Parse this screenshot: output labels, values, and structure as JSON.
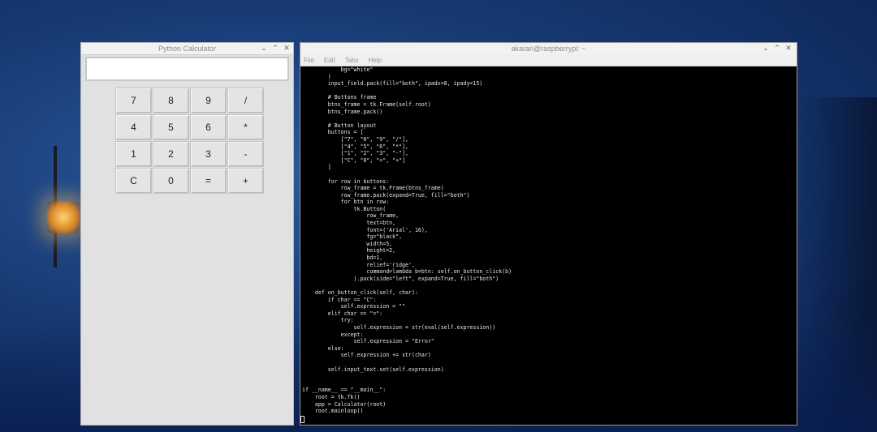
{
  "calculator": {
    "title": "Python Calculator",
    "input_value": "",
    "buttons": [
      "7",
      "8",
      "9",
      "/",
      "4",
      "5",
      "6",
      "*",
      "1",
      "2",
      "3",
      "-",
      "C",
      "0",
      "=",
      "+"
    ]
  },
  "terminal": {
    "title": "akaran@raspberrypi: ~",
    "menu": [
      "File",
      "Edit",
      "Tabs",
      "Help"
    ],
    "code": "            bg=\"white\"\n        )\n        input_field.pack(fill=\"both\", ipadx=8, ipady=15)\n\n        # Buttons frame\n        btns_frame = tk.Frame(self.root)\n        btns_frame.pack()\n\n        # Button layout\n        buttons = [\n            [\"7\", \"8\", \"9\", \"/\"],\n            [\"4\", \"5\", \"6\", \"*\"],\n            [\"1\", \"2\", \"3\", \"-\"],\n            [\"C\", \"0\", \"=\", \"+\"]\n        ]\n\n        for row in buttons:\n            row_frame = tk.Frame(btns_frame)\n            row_frame.pack(expand=True, fill=\"both\")\n            for btn in row:\n                tk.Button(\n                    row_frame,\n                    text=btn,\n                    font=('Arial', 16),\n                    fg=\"black\",\n                    width=5,\n                    height=2,\n                    bd=1,\n                    relief='ridge',\n                    command=lambda b=btn: self.on_button_click(b)\n                ).pack(side=\"left\", expand=True, fill=\"both\")\n\n    def on_button_click(self, char):\n        if char == \"C\":\n            self.expression = \"\"\n        elif char == \"=\":\n            try:\n                self.expression = str(eval(self.expression))\n            except:\n                self.expression = \"Error\"\n        else:\n            self.expression += str(char)\n\n        self.input_text.set(self.expression)\n\n\nif __name__ == \"__main__\":\n    root = tk.Tk()\n    app = Calculator(root)\n    root.mainloop()"
  },
  "window_controls": {
    "minimize": "⌄",
    "maximize": "⌃",
    "close": "✕"
  }
}
